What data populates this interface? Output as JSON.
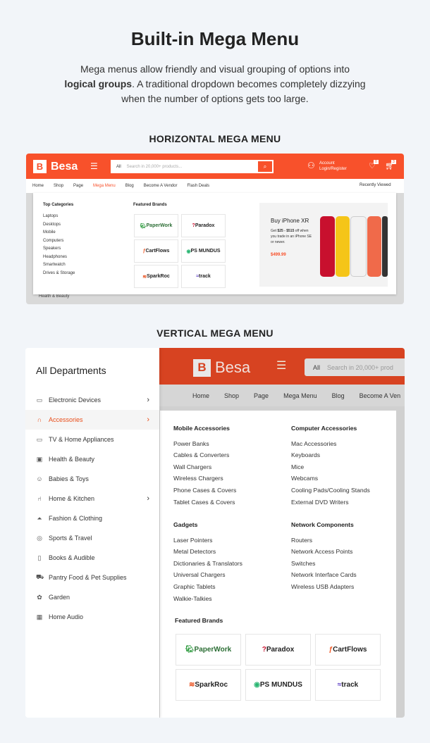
{
  "title": "Built-in Mega Menu",
  "intro": {
    "line1": "Mega menus allow friendly and visual grouping of options into",
    "bold": "logical groups",
    "line2_rest": ". A traditional dropdown becomes completely dizzying",
    "line3": "when the number of options gets too large."
  },
  "horizontal": {
    "heading": "HORIZONTAL MEGA MENU",
    "logo": "Besa",
    "logo_letter": "B",
    "search": {
      "category": "All",
      "placeholder": "Search in 20,000+ products..."
    },
    "account": {
      "label": "Account",
      "action": "Login/Register"
    },
    "wishlist_count": "0",
    "cart_count": "3",
    "nav": [
      "Home",
      "Shop",
      "Page",
      "Mega Menu",
      "Blog",
      "Become A Vendor",
      "Flash Deals"
    ],
    "active_nav": "Mega Menu",
    "recently_viewed": "Recently Viewed",
    "top_categories": {
      "title": "Top Categories",
      "items": [
        "Laptops",
        "Desktops",
        "Mobile",
        "Computers",
        "Speakers",
        "Headphones",
        "Smartwatch",
        "Drives & Storage"
      ]
    },
    "featured_brands": {
      "title": "Featured Brands",
      "items": [
        "PaperWork",
        "Paradox",
        "CartFlows",
        "PS MUNDUS",
        "SparkRoc",
        "track"
      ]
    },
    "promo": {
      "title": "Buy iPhone XR",
      "text_pre": "Get ",
      "text_bold": "$25 - $515",
      "text_post": " off when you trade in an iPhone SE or newer.",
      "price": "$499.99"
    },
    "background_text": "Health & Beauty"
  },
  "vertical": {
    "heading": "VERTICAL MEGA MENU",
    "sidebar_title": "All Departments",
    "departments": [
      {
        "label": "Electronic Devices",
        "icon": "laptop-icon",
        "arrow": true
      },
      {
        "label": "Accessories",
        "icon": "headphones-icon",
        "arrow": true,
        "active": true
      },
      {
        "label": "TV & Home Appliances",
        "icon": "tv-icon"
      },
      {
        "label": "Health & Beauty",
        "icon": "health-icon"
      },
      {
        "label": "Babies & Toys",
        "icon": "baby-icon"
      },
      {
        "label": "Home & Kitchen",
        "icon": "chair-icon",
        "arrow": true
      },
      {
        "label": "Fashion & Clothing",
        "icon": "hanger-icon"
      },
      {
        "label": "Sports & Travel",
        "icon": "ball-icon"
      },
      {
        "label": "Books & Audible",
        "icon": "book-icon"
      },
      {
        "label": "Pantry Food & Pet Supplies",
        "icon": "cart-icon"
      },
      {
        "label": "Garden",
        "icon": "plant-icon"
      },
      {
        "label": "Home Audio",
        "icon": "speaker-icon"
      }
    ],
    "logo": "Besa",
    "logo_letter": "B",
    "search": {
      "category": "All",
      "placeholder": "Search in 20,000+ prod"
    },
    "nav": [
      "Home",
      "Shop",
      "Page",
      "Mega Menu",
      "Blog",
      "Become A Ven"
    ],
    "groups": [
      {
        "title": "Mobile Accessories",
        "items": [
          "Power Banks",
          "Cables & Converters",
          "Wall Chargers",
          "Wireless Chargers",
          "Phone Cases & Covers",
          "Tablet Cases & Covers"
        ]
      },
      {
        "title": "Computer Accessories",
        "items": [
          "Mac Accessories",
          "Keyboards",
          "Mice",
          "Webcams",
          "Cooling Pads/Cooling Stands",
          "External DVD Writers"
        ]
      },
      {
        "title": "Gadgets",
        "items": [
          "Laser Pointers",
          "Metal Detectors",
          "Dictionaries & Translators",
          "Universal Chargers",
          "Graphic Tablets",
          "Walkie-Talkies"
        ]
      },
      {
        "title": "Network Components",
        "items": [
          "Routers",
          "Network Access Points",
          "Switches",
          "Network Interface Cards",
          "Wireless USB Adapters"
        ]
      }
    ],
    "featured_title": "Featured Brands",
    "brands": [
      "PaperWork",
      "Paradox",
      "CartFlows",
      "SparkRoc",
      "PS MUNDUS",
      "track"
    ]
  },
  "colors": {
    "accent": "#f8512b",
    "accent_dim": "#d74321",
    "bg": "#f2f5f9"
  }
}
